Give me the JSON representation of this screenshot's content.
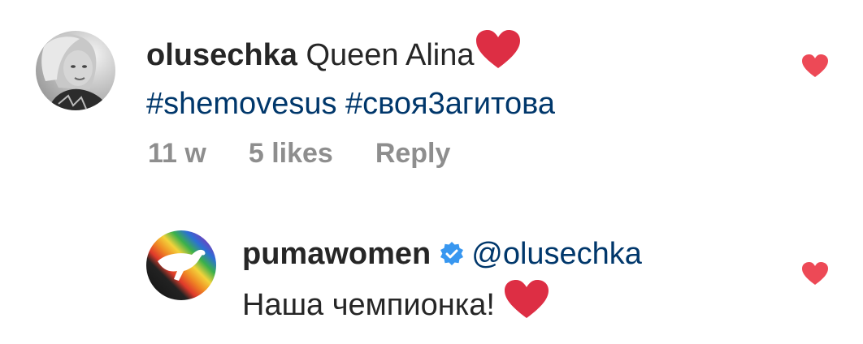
{
  "comments": [
    {
      "username": "olusechka",
      "text": "Queen Alina",
      "hashtags": [
        "#shemovesus",
        "#своя3агитова"
      ],
      "time": "11 w",
      "likes": "5 likes",
      "reply_label": "Reply"
    },
    {
      "username": "pumawomen",
      "verified": true,
      "mention": "@olusechka",
      "text": "Наша чемпионка!",
      "reply": true
    }
  ],
  "icons": {
    "heart_emoji": "red-heart-emoji",
    "like": "heart-like-icon",
    "verified": "verified-badge-icon"
  },
  "colors": {
    "text": "#262626",
    "link": "#00376b",
    "meta": "#8e8e8e",
    "like_heart": "#ed4956",
    "verified": "#3897f0",
    "emoji_heart": "#dd2e44"
  }
}
